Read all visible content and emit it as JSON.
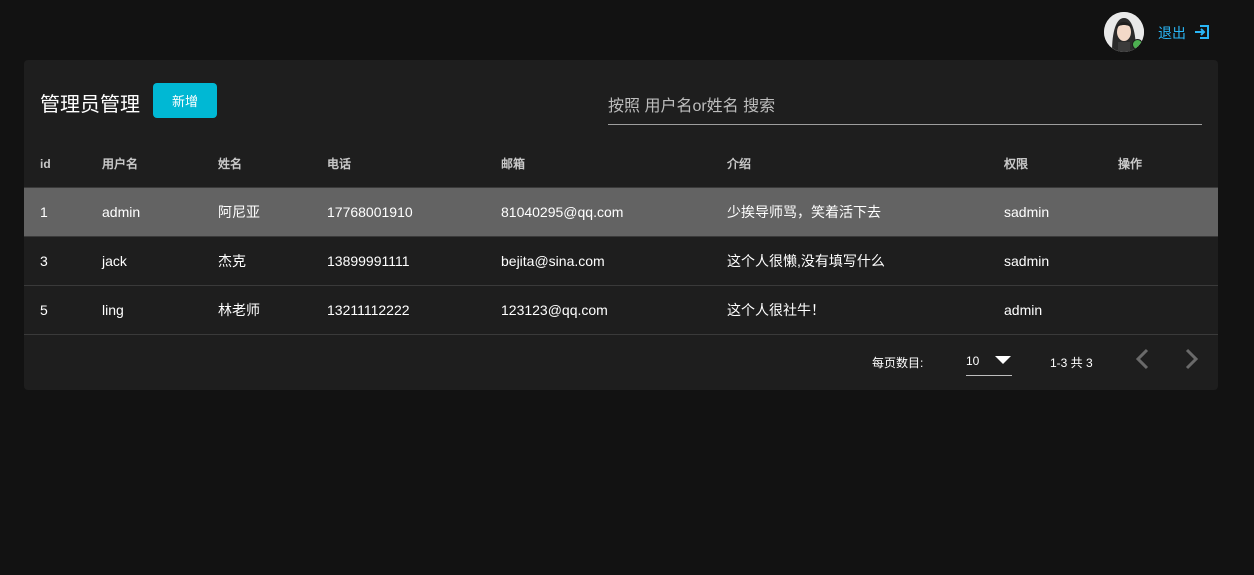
{
  "header": {
    "logout_label": "退出"
  },
  "card": {
    "title": "管理员管理",
    "add_button_label": "新增",
    "search_placeholder": "按照 用户名or姓名 搜索"
  },
  "table": {
    "columns": [
      "id",
      "用户名",
      "姓名",
      "电话",
      "邮箱",
      "介绍",
      "权限",
      "操作"
    ],
    "rows": [
      {
        "id": "1",
        "username": "admin",
        "name": "阿尼亚",
        "phone": "17768001910",
        "email": "81040295@qq.com",
        "intro": "少挨导师骂，笑着活下去",
        "role": "sadmin"
      },
      {
        "id": "3",
        "username": "jack",
        "name": "杰克",
        "phone": "13899991111",
        "email": "bejita@sina.com",
        "intro": "这个人很懒,没有填写什么",
        "role": "sadmin"
      },
      {
        "id": "5",
        "username": "ling",
        "name": "林老师",
        "phone": "13211112222",
        "email": "123123@qq.com",
        "intro": "这个人很社牛！",
        "role": "admin"
      }
    ]
  },
  "pagination": {
    "rows_per_page_label": "每页数目:",
    "rows_per_page_value": "10",
    "range_text": "1-3 共 3"
  },
  "colors": {
    "accent": "#00b8d4",
    "link": "#29b6f6",
    "highlight_row": "#636363"
  }
}
